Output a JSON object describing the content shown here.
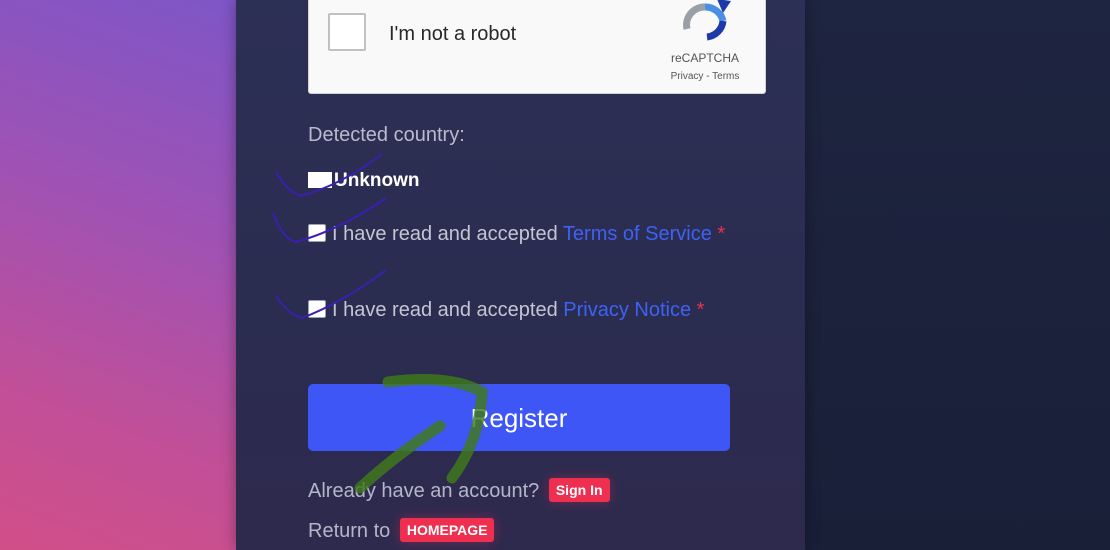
{
  "captcha": {
    "label": "I'm not a robot",
    "brand": "reCAPTCHA",
    "privacy": "Privacy",
    "separator": " - ",
    "terms": "Terms"
  },
  "country": {
    "label": "Detected country:",
    "value": "Unknown"
  },
  "agreements": {
    "tos_prefix": "I have read and accepted ",
    "tos_link": "Terms of Service",
    "privacy_prefix": "I have read and accepted ",
    "privacy_link": "Privacy Notice",
    "required_mark": "*"
  },
  "register": {
    "label": "Register"
  },
  "footer": {
    "account_text": "Already have an account?",
    "sign_in": "Sign In",
    "return_text": "Return to",
    "homepage": "HOMEPAGE"
  },
  "colors": {
    "accent": "#3d56f5",
    "link": "#3e62f2",
    "badge": "#ef2f4f",
    "required": "#e8334f"
  }
}
